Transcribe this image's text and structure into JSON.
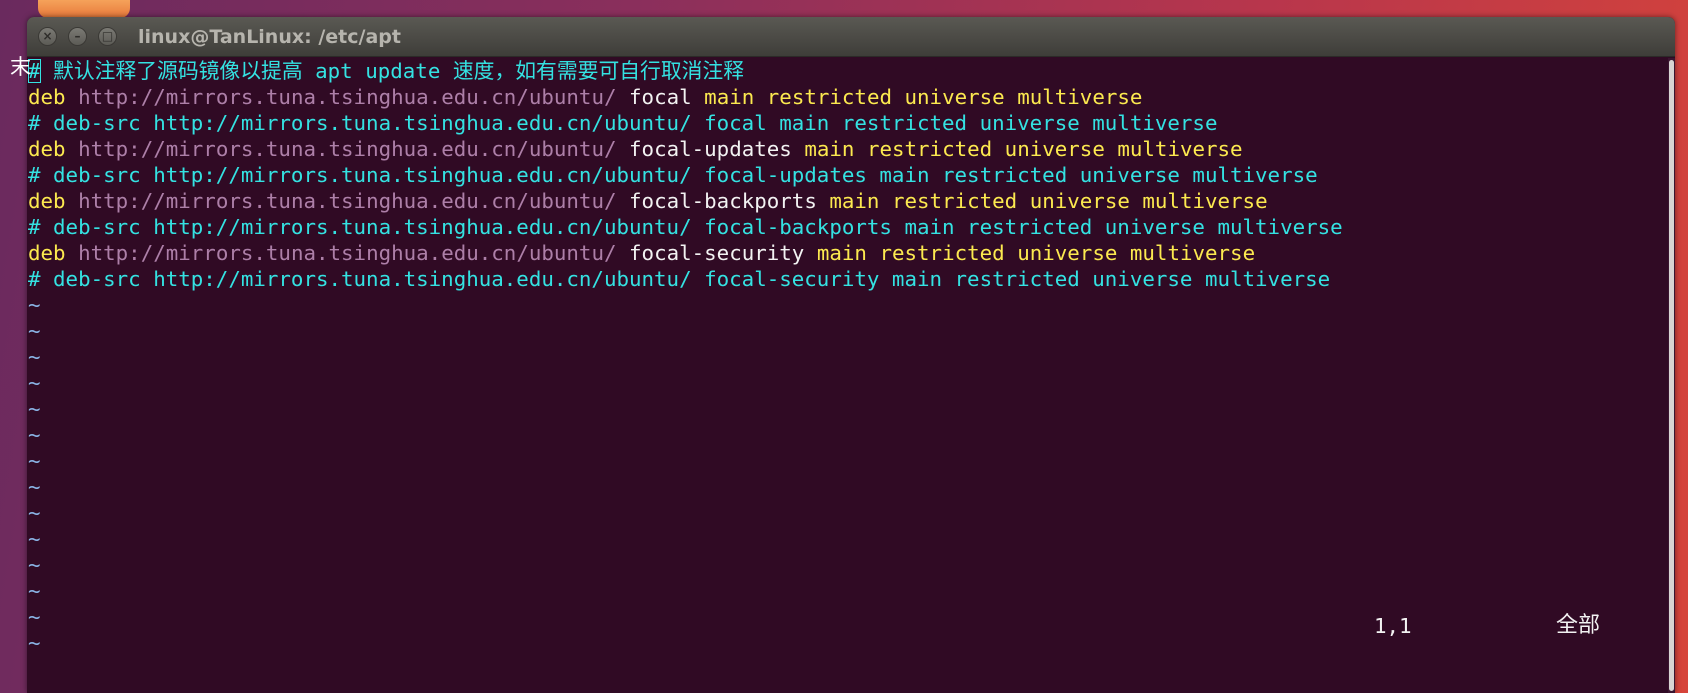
{
  "window": {
    "title": "linux@TanLinux: /etc/apt",
    "buttons": {
      "close": "×",
      "minimize": "–",
      "maximize": "□"
    }
  },
  "editor": {
    "stray_char": "末",
    "lines": [
      {
        "hash": "#",
        "text": " 默认注释了源码镜像以提高 apt update 速度，如有需要可自行取消注释"
      },
      {
        "kw": "deb",
        "url": "http://mirrors.tuna.tsinghua.edu.cn/ubuntu/",
        "suite": "focal",
        "comps": "main restricted universe multiverse"
      },
      {
        "comment": "# deb-src http://mirrors.tuna.tsinghua.edu.cn/ubuntu/ focal main restricted universe multiverse"
      },
      {
        "kw": "deb",
        "url": "http://mirrors.tuna.tsinghua.edu.cn/ubuntu/",
        "suite": "focal-updates",
        "comps": "main restricted universe multiverse"
      },
      {
        "comment": "# deb-src http://mirrors.tuna.tsinghua.edu.cn/ubuntu/ focal-updates main restricted universe multiverse"
      },
      {
        "kw": "deb",
        "url": "http://mirrors.tuna.tsinghua.edu.cn/ubuntu/",
        "suite": "focal-backports",
        "comps": "main restricted universe multiverse"
      },
      {
        "comment": "# deb-src http://mirrors.tuna.tsinghua.edu.cn/ubuntu/ focal-backports main restricted universe multiverse"
      },
      {
        "kw": "deb",
        "url": "http://mirrors.tuna.tsinghua.edu.cn/ubuntu/",
        "suite": "focal-security",
        "comps": "main restricted universe multiverse"
      },
      {
        "comment": "# deb-src http://mirrors.tuna.tsinghua.edu.cn/ubuntu/ focal-security main restricted universe multiverse"
      }
    ],
    "empty_line_marker": "~",
    "empty_line_count": 14
  },
  "status": {
    "position": "1,1",
    "scroll": "全部"
  },
  "colors": {
    "background": "#300a24",
    "comment": "#34e2e2",
    "keyword": "#fce94f",
    "url": "#ad7fa8",
    "suite": "#f2f2f2"
  }
}
